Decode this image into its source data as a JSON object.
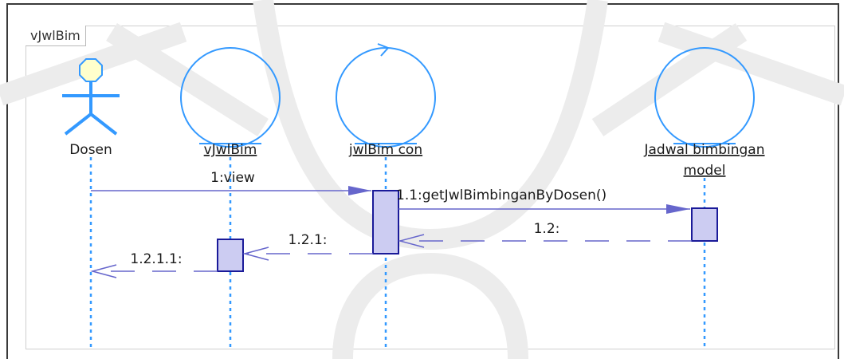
{
  "frame": {
    "name": "vJwlBim"
  },
  "participants": [
    {
      "id": "dosen",
      "kind": "actor",
      "label": [
        "Dosen"
      ]
    },
    {
      "id": "vjwlbim",
      "kind": "boundary",
      "label": [
        "vJwlBim"
      ]
    },
    {
      "id": "jwlbim-con",
      "kind": "control",
      "label": [
        "jwlBim con"
      ]
    },
    {
      "id": "jadwal-model",
      "kind": "entity",
      "label": [
        "Jadwal bimbingan",
        "model"
      ]
    }
  ],
  "messages": [
    {
      "id": "m1",
      "label": "1:view",
      "from": "dosen",
      "to": "jwlbim-con",
      "style": "sync"
    },
    {
      "id": "m11",
      "label": "1.1:getJwlBimbinganByDosen()",
      "from": "jwlbim-con",
      "to": "jadwal-model",
      "style": "sync"
    },
    {
      "id": "m12",
      "label": "1.2:",
      "from": "jadwal-model",
      "to": "jwlbim-con",
      "style": "return"
    },
    {
      "id": "m121",
      "label": "1.2.1:",
      "from": "jwlbim-con",
      "to": "vjwlbim",
      "style": "return"
    },
    {
      "id": "m1211",
      "label": "1.2.1.1:",
      "from": "vjwlbim",
      "to": "dosen",
      "style": "return"
    }
  ],
  "colors": {
    "actor_fill": "#ffffcc",
    "actor_stroke": "#3399ff",
    "object_stroke": "#3399ff",
    "lifeline": "#3399ff",
    "activation_fill": "#ccccf2",
    "activation_stroke": "#1a1a99",
    "message": "#6666cc",
    "arrowhead": "#6666cc"
  }
}
